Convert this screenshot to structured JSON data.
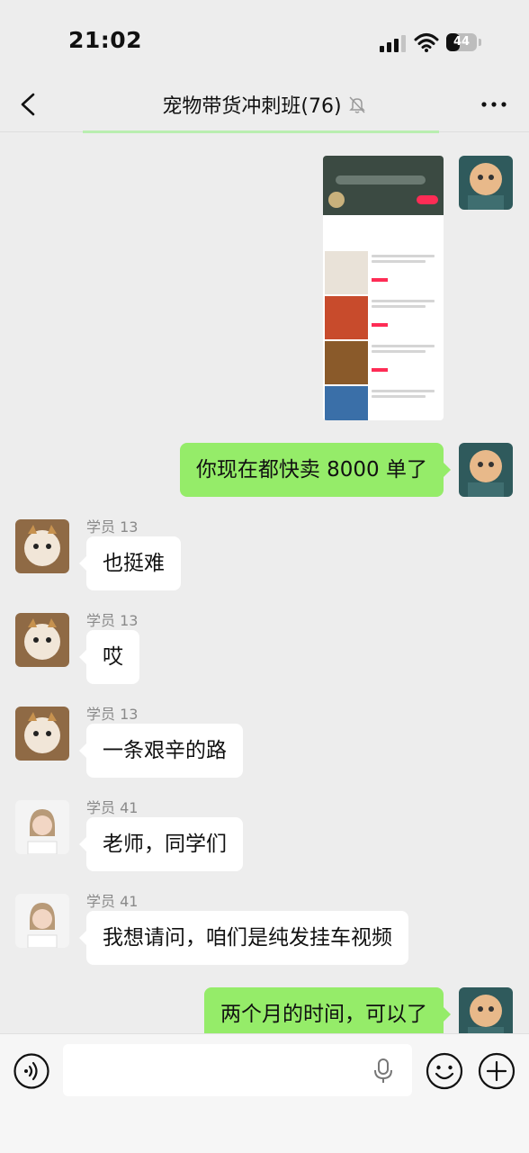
{
  "status_bar": {
    "time": "21:02",
    "battery": "44",
    "battery_level": 0.44
  },
  "header": {
    "title": "宠物带货冲刺班(76)",
    "back_icon": "chevron-left-icon",
    "mute_icon": "bell-slash-icon",
    "more_icon": "more-dots-icon"
  },
  "messages": [
    {
      "type": "image",
      "direction": "out",
      "description_icon": "shared-screenshot"
    },
    {
      "type": "text",
      "direction": "out",
      "text": "你现在都快卖 8000 单了"
    },
    {
      "type": "text",
      "direction": "in",
      "sender": "学员 13",
      "text": "也挺难"
    },
    {
      "type": "text",
      "direction": "in",
      "sender": "学员 13",
      "text": "哎"
    },
    {
      "type": "text",
      "direction": "in",
      "sender": "学员 13",
      "text": "一条艰辛的路"
    },
    {
      "type": "text",
      "direction": "in",
      "sender": "学员 41",
      "text": "老师，同学们"
    },
    {
      "type": "text",
      "direction": "in",
      "sender": "学员 41",
      "text": "我想请问，咱们是纯发挂车视频"
    },
    {
      "type": "text",
      "direction": "out",
      "text": "两个月的时间，可以了"
    }
  ],
  "input_bar": {
    "voice_icon": "voice-icon",
    "mic_icon": "mic-icon",
    "emoji_icon": "emoji-icon",
    "add_icon": "plus-circle-icon",
    "value": ""
  },
  "colors": {
    "background": "#ededed",
    "out_bubble": "#95ec69",
    "in_bubble": "#ffffff"
  }
}
